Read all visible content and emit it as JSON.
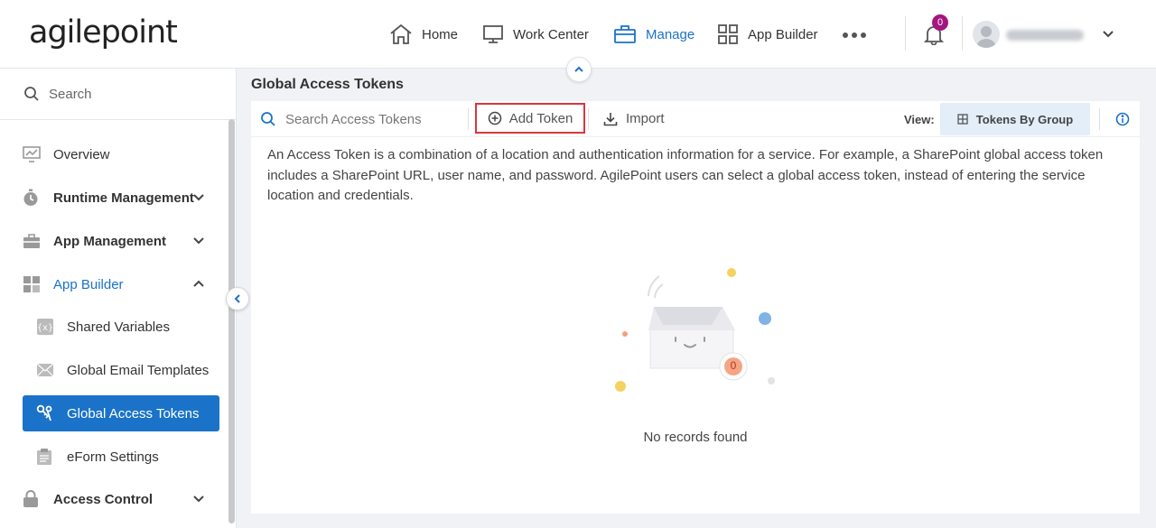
{
  "header": {
    "logo": "agilepoint",
    "nav": [
      {
        "label": "Home",
        "icon": "home-icon"
      },
      {
        "label": "Work Center",
        "icon": "monitor-icon"
      },
      {
        "label": "Manage",
        "icon": "briefcase-icon",
        "active": true
      },
      {
        "label": "App Builder",
        "icon": "grid-icon"
      }
    ],
    "notification_count": "0",
    "accent": "#1a73c8"
  },
  "sidebar": {
    "search_placeholder": "Search",
    "items": [
      {
        "label": "Overview",
        "icon": "chart-icon"
      },
      {
        "label": "Runtime Management",
        "icon": "stopwatch-icon",
        "expandable": true
      },
      {
        "label": "App Management",
        "icon": "briefcase-icon",
        "expandable": true
      },
      {
        "label": "App Builder",
        "icon": "grid-icon",
        "expanded": true
      },
      {
        "label": "Shared Variables",
        "icon": "variable-icon"
      },
      {
        "label": "Global Email Templates",
        "icon": "envelope-icon"
      },
      {
        "label": "Global Access Tokens",
        "icon": "keys-icon",
        "selected": true
      },
      {
        "label": "eForm Settings",
        "icon": "clipboard-icon"
      },
      {
        "label": "Access Control",
        "icon": "lock-icon",
        "expandable": true
      }
    ]
  },
  "main": {
    "title": "Global Access Tokens",
    "toolbar": {
      "search_placeholder": "Search Access Tokens",
      "add_label": "Add Token",
      "import_label": "Import",
      "view_label": "View:",
      "view_value": "Tokens By Group"
    },
    "description": "An Access Token is a combination of a location and authentication information for a service. For example, a SharePoint global access token includes a SharePoint URL, user name, and password. AgilePoint users can select a global access token, instead of entering the service location and credentials.",
    "empty_count": "0",
    "empty_text": "No records found"
  }
}
